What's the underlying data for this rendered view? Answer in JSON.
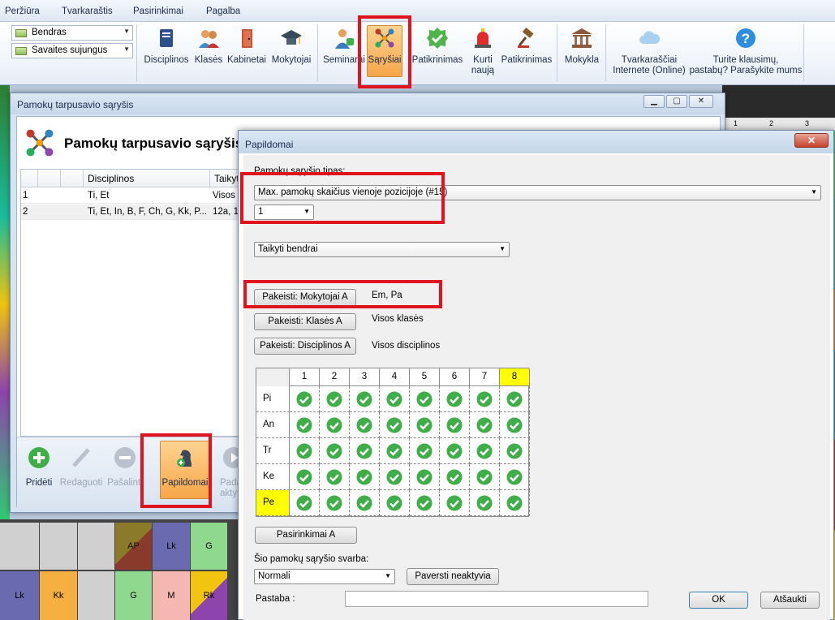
{
  "menu": [
    "Peržiūra",
    "Tvarkaraštis",
    "Pasirinkimai",
    "Pagalba"
  ],
  "ribbon": {
    "combo1": "Bendras",
    "combo2": "Savaites sujungus",
    "buttons": [
      {
        "label": "Disciplinos",
        "icon": "book-icon"
      },
      {
        "label": "Klasės",
        "icon": "students-icon"
      },
      {
        "label": "Kabinetai",
        "icon": "door-icon"
      },
      {
        "label": "Mokytojai",
        "icon": "graduation-cap-icon"
      },
      {
        "label": "Seminarai",
        "icon": "teacher-icon"
      },
      {
        "label": "Sąryšiai",
        "icon": "relations-icon"
      },
      {
        "label": "Patikrinimas",
        "icon": "check-badge-icon"
      },
      {
        "label": "Kurti\nnaują",
        "icon": "siren-icon"
      },
      {
        "label": "Patikrinimas",
        "icon": "gavel-icon"
      },
      {
        "label": "Mokykla",
        "icon": "school-building-icon"
      },
      {
        "label": "Tvarkaraščiai\nInternete (Online)",
        "icon": "cloud-icon"
      },
      {
        "label": "Turite klausimų,\npastabų? Parašykite mums",
        "icon": "question-icon"
      }
    ]
  },
  "main_window": {
    "title": "Pamokų tarpusavio sąryšis",
    "heading": "Pamokų tarpusavio sąryšis",
    "columns": [
      "Disciplinos",
      "Taikyt"
    ],
    "rows": [
      {
        "num": "1",
        "disc": "Ti, Et",
        "apply": "Visos"
      },
      {
        "num": "2",
        "disc": "Ti, Et, In, B, F, Ch, G, Kk, P...",
        "apply": "12a, 1"
      }
    ],
    "toolbar": {
      "add": "Pridėti",
      "edit": "Redaguoti",
      "remove": "Pašalinti",
      "extra": "Papildomai",
      "make_active": "Padar\naktyv"
    }
  },
  "dialog": {
    "title": "Papildomai",
    "close_label": "✕",
    "type_label": "Pamokų sąryšio tipas:",
    "type_value": "Max. pamokų skaičius vienoje pozicijoje (#15)",
    "count_value": "1",
    "apply_value": "Taikyti bendrai",
    "change_teachers": "Pakeisti: Mokytojai A",
    "teachers_value": "Em, Pa",
    "change_classes": "Pakeisti: Klasės A",
    "classes_value": "Visos klasės",
    "change_subjects": "Pakeisti: Disciplinos A",
    "subjects_value": "Visos disciplinos",
    "grid": {
      "periods": [
        "1",
        "2",
        "3",
        "4",
        "5",
        "6",
        "7",
        "8"
      ],
      "days": [
        "Pi",
        "An",
        "Tr",
        "Ke",
        "Pe"
      ],
      "highlight_period": "8",
      "highlight_day": "Pe",
      "all_checked": true
    },
    "options_button": "Pasirinkimai A",
    "importance_label": "Šio pamokų sąryšio svarba:",
    "importance_value": "Normali",
    "deactivate_button": "Paversti neaktyvia",
    "note_label": "Pastaba :",
    "note_value": "",
    "ok": "OK",
    "cancel": "Atšaukti"
  },
  "colors": {
    "highlight_red": "#e0141e",
    "active_orange": "#f6a648",
    "check_green": "#3fae49",
    "grid_yellow": "#ffff00"
  },
  "background_tiles": [
    "AP",
    "Lk",
    "G",
    "Lk",
    "Kk",
    "G",
    "M",
    "Rk"
  ],
  "bg_col_numbers": [
    "1",
    "2",
    "3"
  ]
}
